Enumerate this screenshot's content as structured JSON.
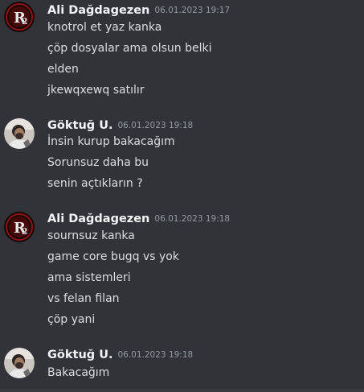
{
  "messages": [
    {
      "author": "Ali Dağdagezen",
      "timestamp": "06.01.2023 19:17",
      "avatar_icon": "r2-logo-avatar",
      "lines": [
        "knotrol et yaz kanka",
        "çöp dosyalar ama olsun belki",
        "elden",
        "jkewqxewq satılır"
      ]
    },
    {
      "author": "Göktuğ U.",
      "timestamp": "06.01.2023 19:18",
      "avatar_icon": "person-photo-avatar",
      "lines": [
        "İnsin kurup bakacağım",
        "Sorunsuz daha bu",
        "senin açtıkların ?"
      ]
    },
    {
      "author": "Ali Dağdagezen",
      "timestamp": "06.01.2023 19:18",
      "avatar_icon": "r2-logo-avatar",
      "lines": [
        "sournsuz kanka",
        "game core bugq vs yok",
        "ama sistemleri",
        "vs felan filan",
        "çöp yani"
      ]
    },
    {
      "author": "Göktuğ U.",
      "timestamp": "06.01.2023 19:18",
      "avatar_icon": "person-photo-avatar",
      "lines": [
        "Bakacağım"
      ]
    }
  ],
  "colors": {
    "background": "#313338",
    "username": "#f2f3f5",
    "timestamp": "#949ba4",
    "message_text": "#dbdee1"
  }
}
